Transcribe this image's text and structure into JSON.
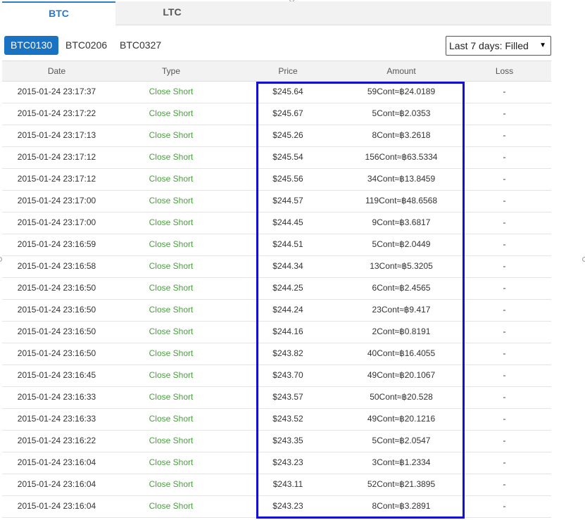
{
  "tabs": [
    {
      "label": "BTC",
      "active": true
    },
    {
      "label": "LTC",
      "active": false
    }
  ],
  "contracts": [
    {
      "label": "BTC0130",
      "active": true
    },
    {
      "label": "BTC0206",
      "active": false
    },
    {
      "label": "BTC0327",
      "active": false
    }
  ],
  "filter": {
    "selected": "Last 7 days: Filled"
  },
  "table": {
    "columns": {
      "date": "Date",
      "type": "Type",
      "price": "Price",
      "amount": "Amount",
      "loss": "Loss"
    },
    "rows": [
      {
        "date": "2015-01-24 23:17:37",
        "type": "Close Short",
        "price": "$245.64",
        "amount": "59Cont≈฿24.0189",
        "loss": "-"
      },
      {
        "date": "2015-01-24 23:17:22",
        "type": "Close Short",
        "price": "$245.67",
        "amount": "5Cont≈฿2.0353",
        "loss": "-"
      },
      {
        "date": "2015-01-24 23:17:13",
        "type": "Close Short",
        "price": "$245.26",
        "amount": "8Cont≈฿3.2618",
        "loss": "-"
      },
      {
        "date": "2015-01-24 23:17:12",
        "type": "Close Short",
        "price": "$245.54",
        "amount": "156Cont≈฿63.5334",
        "loss": "-"
      },
      {
        "date": "2015-01-24 23:17:12",
        "type": "Close Short",
        "price": "$245.56",
        "amount": "34Cont≈฿13.8459",
        "loss": "-"
      },
      {
        "date": "2015-01-24 23:17:00",
        "type": "Close Short",
        "price": "$244.57",
        "amount": "119Cont≈฿48.6568",
        "loss": "-"
      },
      {
        "date": "2015-01-24 23:17:00",
        "type": "Close Short",
        "price": "$244.45",
        "amount": "9Cont≈฿3.6817",
        "loss": "-"
      },
      {
        "date": "2015-01-24 23:16:59",
        "type": "Close Short",
        "price": "$244.51",
        "amount": "5Cont≈฿2.0449",
        "loss": "-"
      },
      {
        "date": "2015-01-24 23:16:58",
        "type": "Close Short",
        "price": "$244.34",
        "amount": "13Cont≈฿5.3205",
        "loss": "-"
      },
      {
        "date": "2015-01-24 23:16:50",
        "type": "Close Short",
        "price": "$244.25",
        "amount": "6Cont≈฿2.4565",
        "loss": "-"
      },
      {
        "date": "2015-01-24 23:16:50",
        "type": "Close Short",
        "price": "$244.24",
        "amount": "23Cont≈฿9.417",
        "loss": "-"
      },
      {
        "date": "2015-01-24 23:16:50",
        "type": "Close Short",
        "price": "$244.16",
        "amount": "2Cont≈฿0.8191",
        "loss": "-"
      },
      {
        "date": "2015-01-24 23:16:50",
        "type": "Close Short",
        "price": "$243.82",
        "amount": "40Cont≈฿16.4055",
        "loss": "-"
      },
      {
        "date": "2015-01-24 23:16:45",
        "type": "Close Short",
        "price": "$243.70",
        "amount": "49Cont≈฿20.1067",
        "loss": "-"
      },
      {
        "date": "2015-01-24 23:16:33",
        "type": "Close Short",
        "price": "$243.57",
        "amount": "50Cont≈฿20.528",
        "loss": "-"
      },
      {
        "date": "2015-01-24 23:16:33",
        "type": "Close Short",
        "price": "$243.52",
        "amount": "49Cont≈฿20.1216",
        "loss": "-"
      },
      {
        "date": "2015-01-24 23:16:22",
        "type": "Close Short",
        "price": "$243.35",
        "amount": "5Cont≈฿2.0547",
        "loss": "-"
      },
      {
        "date": "2015-01-24 23:16:04",
        "type": "Close Short",
        "price": "$243.23",
        "amount": "3Cont≈฿1.2334",
        "loss": "-"
      },
      {
        "date": "2015-01-24 23:16:04",
        "type": "Close Short",
        "price": "$243.11",
        "amount": "52Cont≈฿21.3895",
        "loss": "-"
      },
      {
        "date": "2015-01-24 23:16:04",
        "type": "Close Short",
        "price": "$243.23",
        "amount": "8Cont≈฿3.2891",
        "loss": "-"
      }
    ]
  },
  "colors": {
    "active_tab": "#2679c9",
    "active_contract": "#1a73c2",
    "type_text": "#4a9e3f",
    "highlight_box": "#1010d8"
  }
}
